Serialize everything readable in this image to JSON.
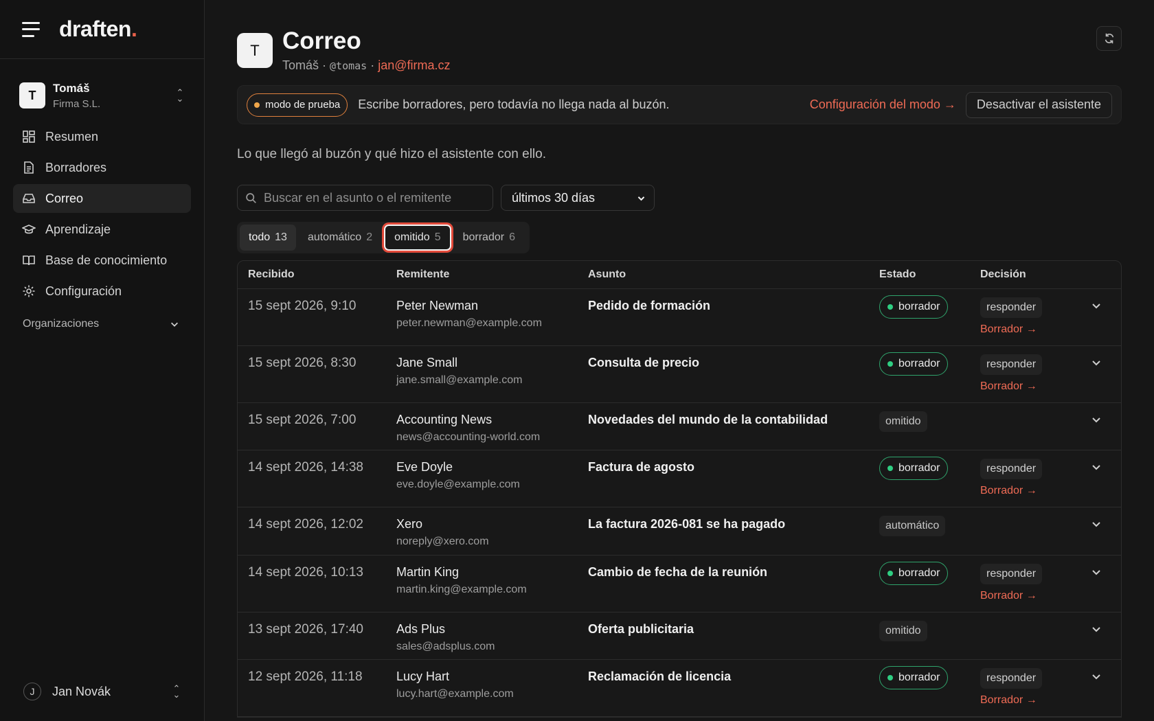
{
  "app": {
    "logo_text": "draften",
    "logo_dot": "."
  },
  "account": {
    "initial": "T",
    "name": "Tomáš",
    "org": "Firma S.L."
  },
  "sidebar": {
    "items": [
      {
        "label": "Resumen",
        "icon": "dashboard-icon"
      },
      {
        "label": "Borradores",
        "icon": "document-icon"
      },
      {
        "label": "Correo",
        "icon": "inbox-icon",
        "active": true
      },
      {
        "label": "Aprendizaje",
        "icon": "graduation-cap-icon"
      },
      {
        "label": "Base de conocimiento",
        "icon": "book-icon"
      },
      {
        "label": "Configuración",
        "icon": "gear-icon"
      }
    ],
    "orgs_label": "Organizaciones"
  },
  "user": {
    "initial": "J",
    "name": "Jan Novák"
  },
  "header": {
    "avatar": "T",
    "title": "Correo",
    "sub_name": "Tomáš ·",
    "sub_handle": "@tomas",
    "sub_sep": "·",
    "sub_email": "jan@firma.cz"
  },
  "banner": {
    "badge": "modo de prueba",
    "text": "Escribe borradores, pero todavía no llega nada al buzón.",
    "link": "Configuración del modo →",
    "button": "Desactivar el asistente"
  },
  "intro": "Lo que llegó al buzón y qué hizo el asistente con ello.",
  "search": {
    "placeholder": "Buscar en el asunto o el remitente"
  },
  "period": {
    "selected": "últimos 30 días"
  },
  "tabs": [
    {
      "label": "todo",
      "count": "13"
    },
    {
      "label": "automático",
      "count": "2"
    },
    {
      "label": "omitido",
      "count": "5"
    },
    {
      "label": "borrador",
      "count": "6"
    }
  ],
  "table": {
    "headers": {
      "date": "Recibido",
      "from": "Remitente",
      "subject": "Asunto",
      "state": "Estado",
      "decision": "Decisión"
    },
    "rows": [
      {
        "date": "15 sept 2026, 9:10",
        "name": "Peter Newman",
        "email": "peter.newman@example.com",
        "subject": "Pedido de formación",
        "state": "borrador",
        "decision": "responder",
        "link": "Borrador →"
      },
      {
        "date": "15 sept 2026, 8:30",
        "name": "Jane Small",
        "email": "jane.small@example.com",
        "subject": "Consulta de precio",
        "state": "borrador",
        "decision": "responder",
        "link": "Borrador →"
      },
      {
        "date": "15 sept 2026, 7:00",
        "name": "Accounting News",
        "email": "news@accounting-world.com",
        "subject": "Novedades del mundo de la contabilidad",
        "state": "omitido"
      },
      {
        "date": "14 sept 2026, 14:38",
        "name": "Eve Doyle",
        "email": "eve.doyle@example.com",
        "subject": "Factura de agosto",
        "state": "borrador",
        "decision": "responder",
        "link": "Borrador →"
      },
      {
        "date": "14 sept 2026, 12:02",
        "name": "Xero",
        "email": "noreply@xero.com",
        "subject": "La factura 2026-081 se ha pagado",
        "state": "automático"
      },
      {
        "date": "14 sept 2026, 10:13",
        "name": "Martin King",
        "email": "martin.king@example.com",
        "subject": "Cambio de fecha de la reunión",
        "state": "borrador",
        "decision": "responder",
        "link": "Borrador →"
      },
      {
        "date": "13 sept 2026, 17:40",
        "name": "Ads Plus",
        "email": "sales@adsplus.com",
        "subject": "Oferta publicitaria",
        "state": "omitido"
      },
      {
        "date": "12 sept 2026, 11:18",
        "name": "Lucy Hart",
        "email": "lucy.hart@example.com",
        "subject": "Reclamación de licencia",
        "state": "borrador",
        "decision": "responder",
        "link": "Borrador →"
      }
    ]
  }
}
